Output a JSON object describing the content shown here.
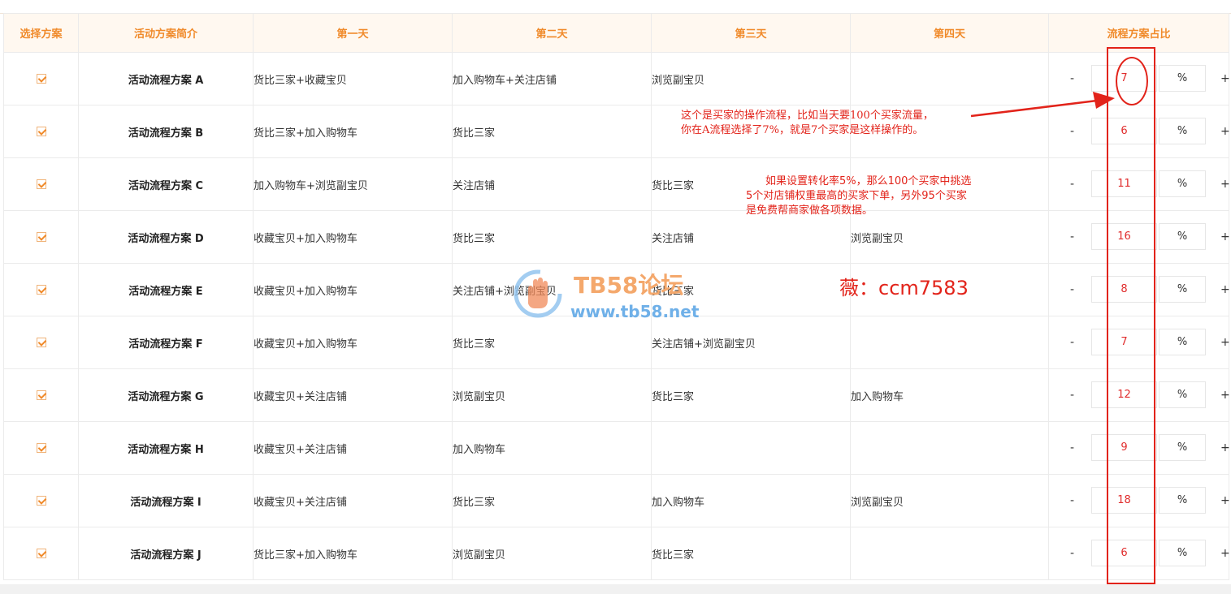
{
  "headers": [
    "选择方案",
    "活动方案简介",
    "第一天",
    "第二天",
    "第三天",
    "第四天",
    "流程方案占比"
  ],
  "rows": [
    {
      "name": "活动流程方案 A",
      "day1": "货比三家+收藏宝贝",
      "day2": "加入购物车+关注店铺",
      "day3": "浏览副宝贝",
      "day4": "",
      "ratio": "7",
      "unit": "%",
      "minus": "-",
      "plus": "+"
    },
    {
      "name": "活动流程方案 B",
      "day1": "货比三家+加入购物车",
      "day2": "货比三家",
      "day3": "",
      "day4": "",
      "ratio": "6",
      "unit": "%",
      "minus": "-",
      "plus": "+"
    },
    {
      "name": "活动流程方案 C",
      "day1": "加入购物车+浏览副宝贝",
      "day2": "关注店铺",
      "day3": "货比三家",
      "day4": "",
      "ratio": "11",
      "unit": "%",
      "minus": "-",
      "plus": "+"
    },
    {
      "name": "活动流程方案 D",
      "day1": "收藏宝贝+加入购物车",
      "day2": "货比三家",
      "day3": "关注店铺",
      "day4": "浏览副宝贝",
      "ratio": "16",
      "unit": "%",
      "minus": "-",
      "plus": "+"
    },
    {
      "name": "活动流程方案 E",
      "day1": "收藏宝贝+加入购物车",
      "day2": "关注店铺+浏览副宝贝",
      "day3": "货比三家",
      "day4": "",
      "ratio": "8",
      "unit": "%",
      "minus": "-",
      "plus": "+"
    },
    {
      "name": "活动流程方案 F",
      "day1": "收藏宝贝+加入购物车",
      "day2": "货比三家",
      "day3": "关注店铺+浏览副宝贝",
      "day4": "",
      "ratio": "7",
      "unit": "%",
      "minus": "-",
      "plus": "+"
    },
    {
      "name": "活动流程方案 G",
      "day1": "收藏宝贝+关注店铺",
      "day2": "浏览副宝贝",
      "day3": "货比三家",
      "day4": "加入购物车",
      "ratio": "12",
      "unit": "%",
      "minus": "-",
      "plus": "+"
    },
    {
      "name": "活动流程方案 H",
      "day1": "收藏宝贝+关注店铺",
      "day2": "加入购物车",
      "day3": "",
      "day4": "",
      "ratio": "9",
      "unit": "%",
      "minus": "-",
      "plus": "+"
    },
    {
      "name": "活动流程方案 I",
      "day1": "收藏宝贝+关注店铺",
      "day2": "货比三家",
      "day3": "加入购物车",
      "day4": "浏览副宝贝",
      "ratio": "18",
      "unit": "%",
      "minus": "-",
      "plus": "+"
    },
    {
      "name": "活动流程方案 J",
      "day1": "货比三家+加入购物车",
      "day2": "浏览副宝贝",
      "day3": "货比三家",
      "day4": "",
      "ratio": "6",
      "unit": "%",
      "minus": "-",
      "plus": "+"
    }
  ],
  "annotations": {
    "note1_line1": "这个是买家的操作流程，比如当天要100个买家流量，",
    "note1_line2": "你在A流程选择了7%，就是7个买家是这样操作的。",
    "note2_line1": "如果设置转化率5%，那么100个买家中挑选",
    "note2_line2": "5个对店铺权重最高的买家下单，另外95个买家",
    "note2_line3": "是免费帮商家做各项数据。",
    "wechat": "薇：ccm7583"
  },
  "watermark": {
    "title": "TB58论坛",
    "url": "www.tb58.net"
  },
  "colors": {
    "accent_orange": "#f08a2a",
    "header_bg": "#fff8f0",
    "annotation_red": "#e2231a",
    "watermark_orange": "#f4a86c",
    "watermark_blue": "#6fb0e8"
  }
}
